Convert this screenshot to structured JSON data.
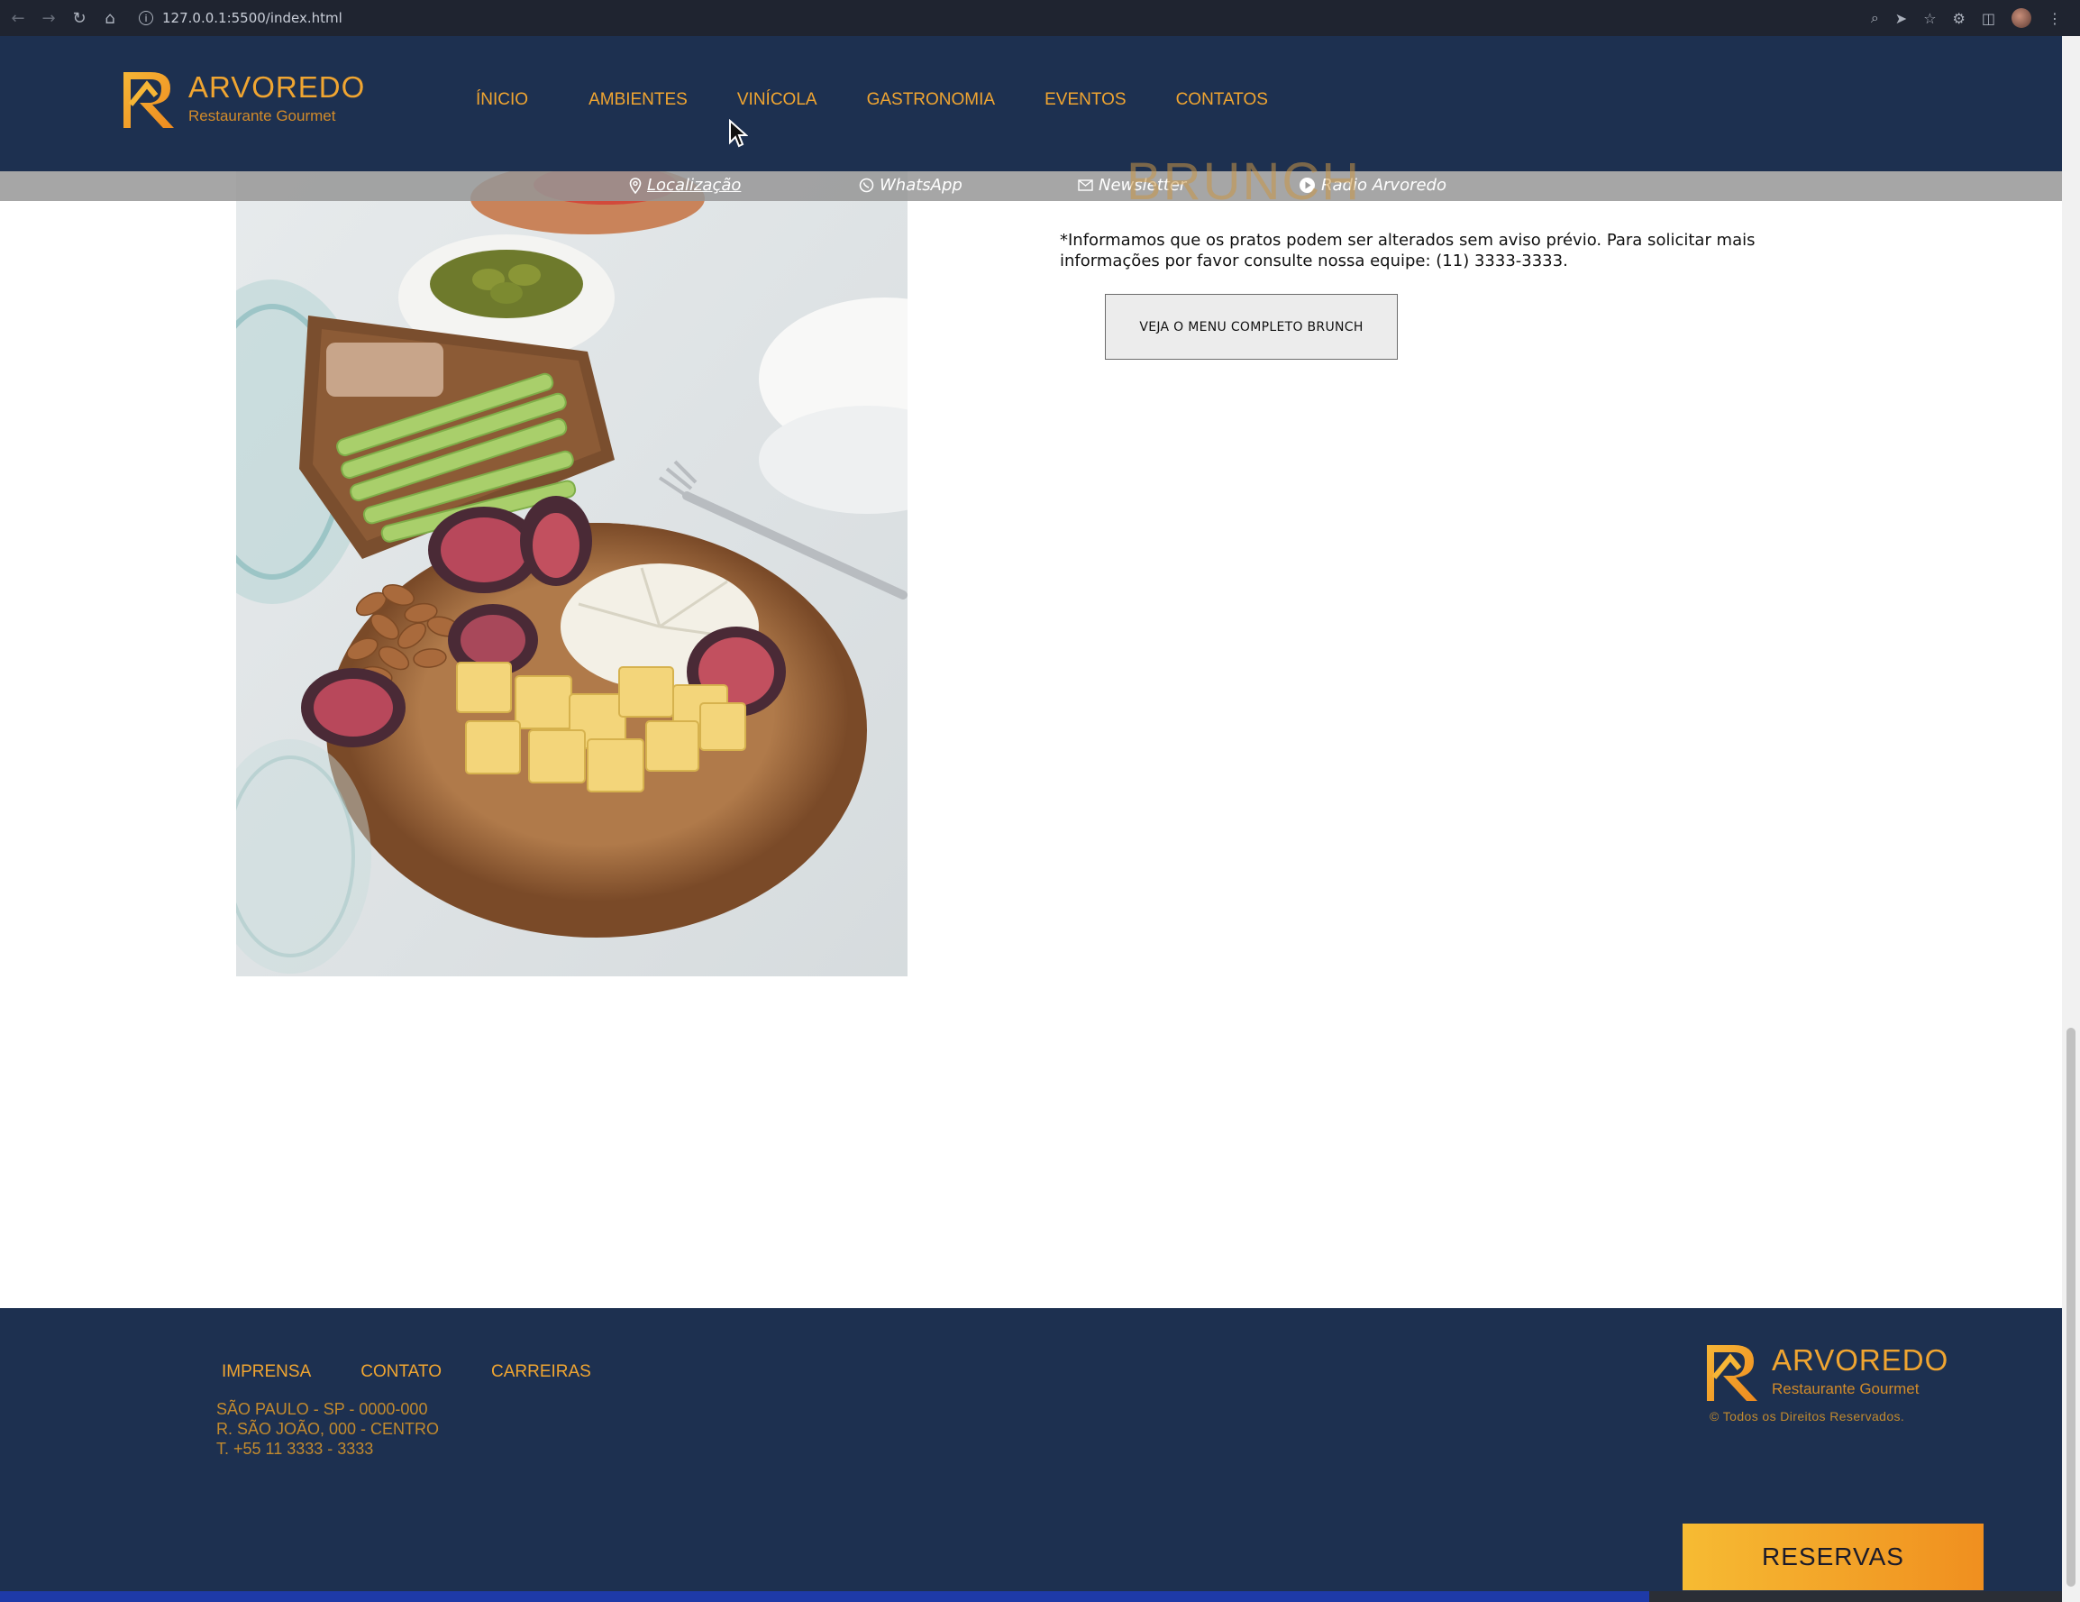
{
  "browser": {
    "url": "127.0.0.1:5500/index.html"
  },
  "header": {
    "logo_brand": "ARVOREDO",
    "logo_sub": "Restaurante Gourmet",
    "nav": [
      {
        "label": "ÍNICIO"
      },
      {
        "label": "AMBIENTES"
      },
      {
        "label": "VINÍCOLA"
      },
      {
        "label": "GASTRONOMIA"
      },
      {
        "label": "EVENTOS"
      },
      {
        "label": "CONTATOS"
      }
    ]
  },
  "subbar": {
    "links": [
      {
        "label": "Localização",
        "icon": "location-pin-icon"
      },
      {
        "label": "WhatsApp",
        "icon": "whatsapp-icon"
      },
      {
        "label": "Newsletter",
        "icon": "mail-icon"
      },
      {
        "label": "Radio Arvoredo",
        "icon": "play-circle-icon"
      }
    ]
  },
  "main": {
    "section_title": "BRUNCH",
    "notice": "*Informamos que os pratos podem ser alterados sem aviso prévio. Para solicitar mais informações por favor consulte nossa equipe: (11) 3333-3333.",
    "menu_button": "VEJA O MENU COMPLETO BRUNCH"
  },
  "footer": {
    "links": [
      {
        "label": "IMPRENSA"
      },
      {
        "label": "CONTATO"
      },
      {
        "label": "CARREIRAS"
      }
    ],
    "address_lines": [
      "SÃO PAULO - SP - 0000-000",
      "R. SÃO JOÃO, 000 - CENTRO",
      "T. +55 11 3333 - 3333"
    ],
    "logo_brand": "ARVOREDO",
    "logo_sub": "Restaurante Gourmet",
    "copyright": "© Todos os Direitos Reservados."
  },
  "reserve_button": "RESERVAS",
  "colors": {
    "navy": "#1d3050",
    "accent": "#f0a531",
    "accent_dark": "#c28a2e"
  }
}
